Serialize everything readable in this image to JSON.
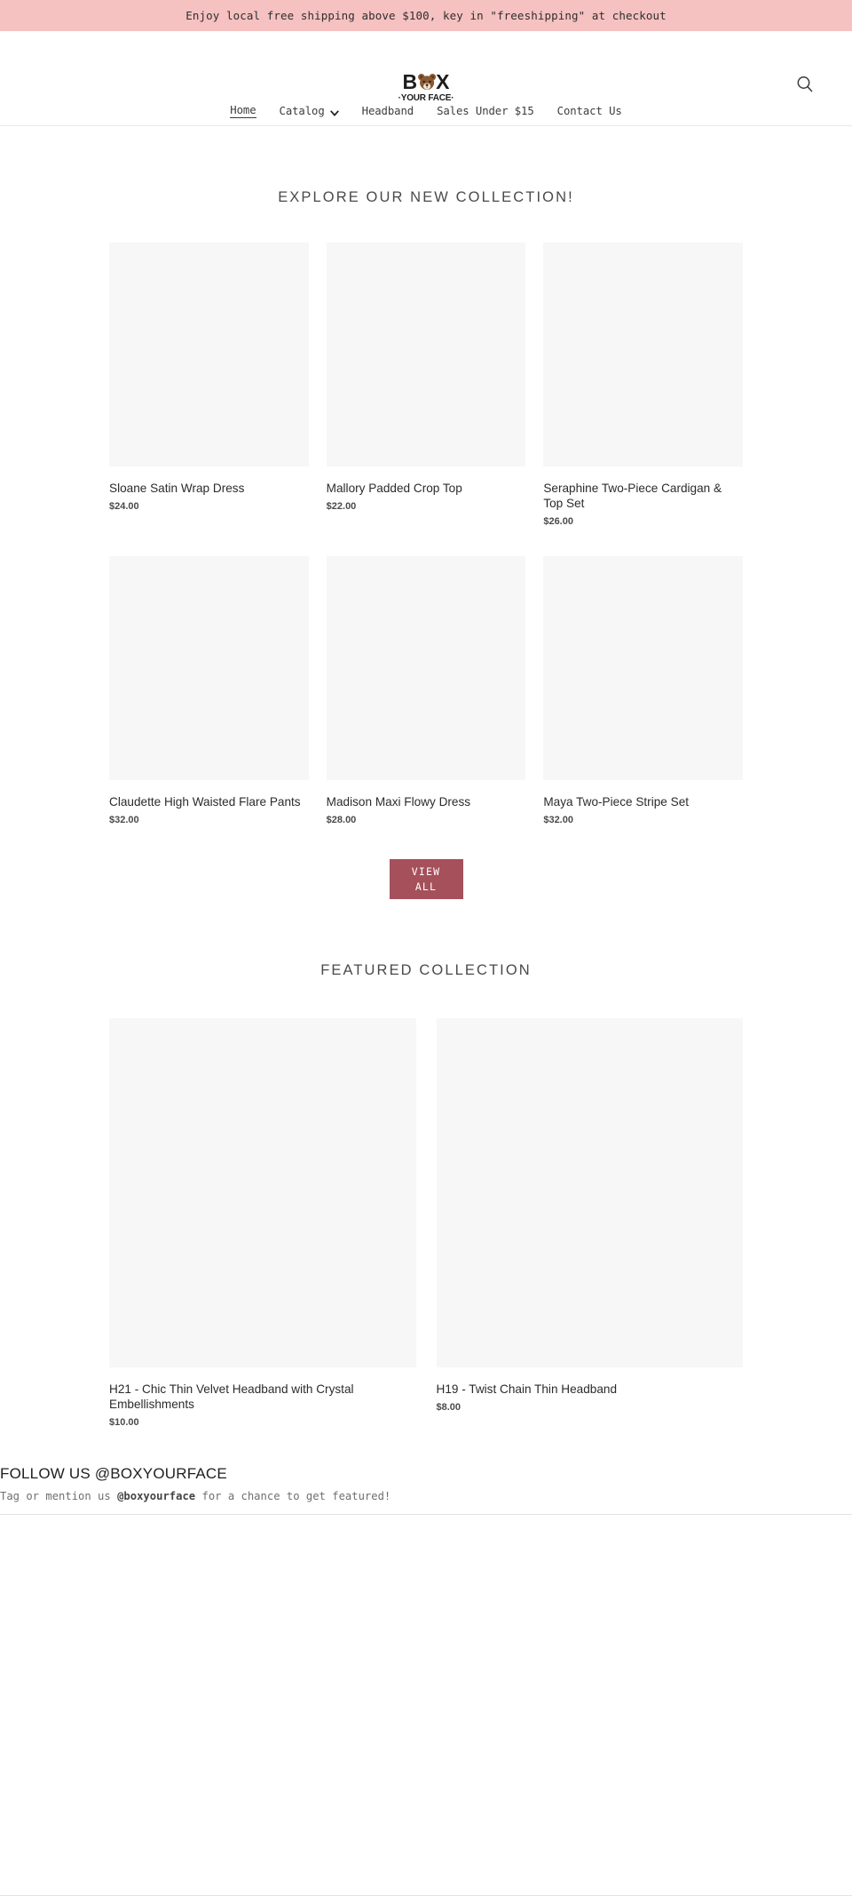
{
  "announcement": {
    "text": "Enjoy local free shipping above $100, key in \"freeshipping\" at checkout",
    "background": "#f6c1c1"
  },
  "header": {
    "logo": {
      "word_left": "B",
      "word_right": "X",
      "icon": "bear-head-icon",
      "tagline": "·YOUR FACE·"
    },
    "search_icon": "search-icon",
    "nav": [
      {
        "label": "Home",
        "active": true,
        "has_dropdown": false
      },
      {
        "label": "Catalog",
        "active": false,
        "has_dropdown": true
      },
      {
        "label": "Headband",
        "active": false,
        "has_dropdown": false
      },
      {
        "label": "Sales Under $15",
        "active": false,
        "has_dropdown": false
      },
      {
        "label": "Contact Us",
        "active": false,
        "has_dropdown": false
      }
    ]
  },
  "new_collection": {
    "title": "EXPLORE OUR NEW COLLECTION!",
    "products": [
      {
        "title": "Sloane Satin Wrap Dress",
        "price": "$24.00"
      },
      {
        "title": "Mallory Padded Crop Top",
        "price": "$22.00"
      },
      {
        "title": "Seraphine Two-Piece Cardigan & Top Set",
        "price": "$26.00"
      },
      {
        "title": "Claudette High Waisted Flare Pants",
        "price": "$32.00"
      },
      {
        "title": "Madison Maxi Flowy Dress",
        "price": "$28.00"
      },
      {
        "title": "Maya Two-Piece Stripe Set",
        "price": "$32.00"
      }
    ],
    "view_all_line1": "VIEW",
    "view_all_line2": "ALL",
    "view_all_color": "#a5505b"
  },
  "featured_collection": {
    "title": "FEATURED COLLECTION",
    "products": [
      {
        "title": "H21 - Chic Thin Velvet Headband with Crystal Embellishments",
        "price": "$10.00"
      },
      {
        "title": "H19 - Twist Chain Thin Headband",
        "price": "$8.00"
      }
    ]
  },
  "follow": {
    "title": "FOLLOW US @BOXYOURFACE",
    "sub_before": "Tag or mention us ",
    "sub_handle": "@boxyourface",
    "sub_after": " for a chance to get featured!"
  }
}
